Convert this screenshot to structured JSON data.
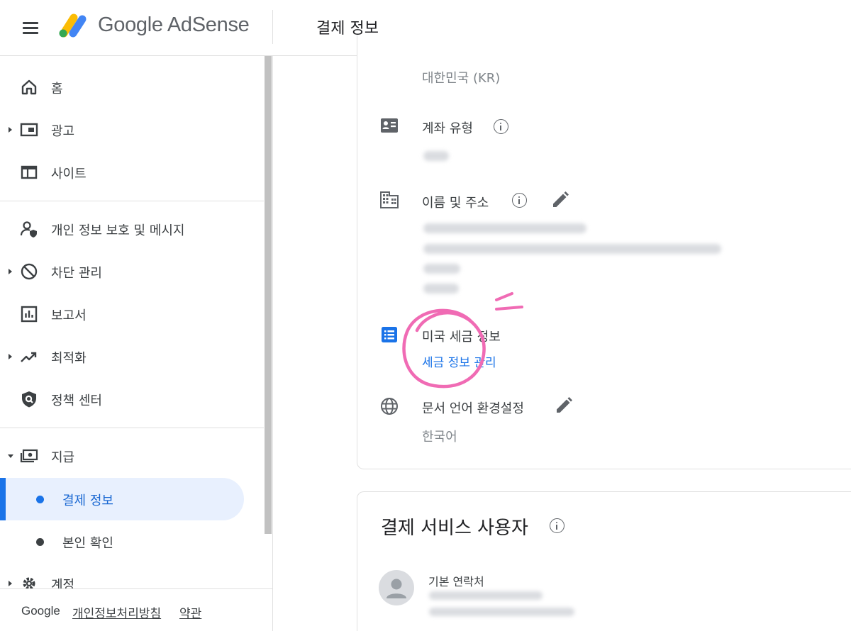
{
  "header": {
    "brand": "Google AdSense",
    "page_title": "결제 정보"
  },
  "sidebar": {
    "items": [
      {
        "label": "홈",
        "icon": "home-icon"
      },
      {
        "label": "광고",
        "icon": "ad-unit-icon"
      },
      {
        "label": "사이트",
        "icon": "site-icon"
      },
      {
        "label": "개인 정보 보호 및 메시지",
        "icon": "privacy-person-icon"
      },
      {
        "label": "차단 관리",
        "icon": "block-icon"
      },
      {
        "label": "보고서",
        "icon": "report-chart-icon"
      },
      {
        "label": "최적화",
        "icon": "trending-up-icon"
      },
      {
        "label": "정책 센터",
        "icon": "shield-icon"
      },
      {
        "label": "지급",
        "icon": "payments-icon"
      },
      {
        "label": "계정",
        "icon": "gear-icon"
      }
    ],
    "sub_items": [
      {
        "label": "결제 정보",
        "active": true
      },
      {
        "label": "본인 확인",
        "active": false
      }
    ],
    "footer": {
      "google": "Google",
      "privacy": "개인정보처리방침",
      "terms": "약관"
    }
  },
  "payment_info": {
    "country_value": "대한민국 (KR)",
    "account_type_label": "계좌 유형",
    "name_address_label": "이름 및 주소",
    "us_tax_label": "미국 세금 정보",
    "us_tax_link": "세금 정보 관리",
    "doc_lang_label": "문서 언어 환경설정",
    "doc_lang_value": "한국어"
  },
  "payments_users": {
    "title": "결제 서비스 사용자",
    "primary_contact_label": "기본 연락처"
  },
  "colors": {
    "accent": "#1a73e8",
    "active_bg": "#e8f0fe",
    "annotation": "#f06bb4"
  }
}
